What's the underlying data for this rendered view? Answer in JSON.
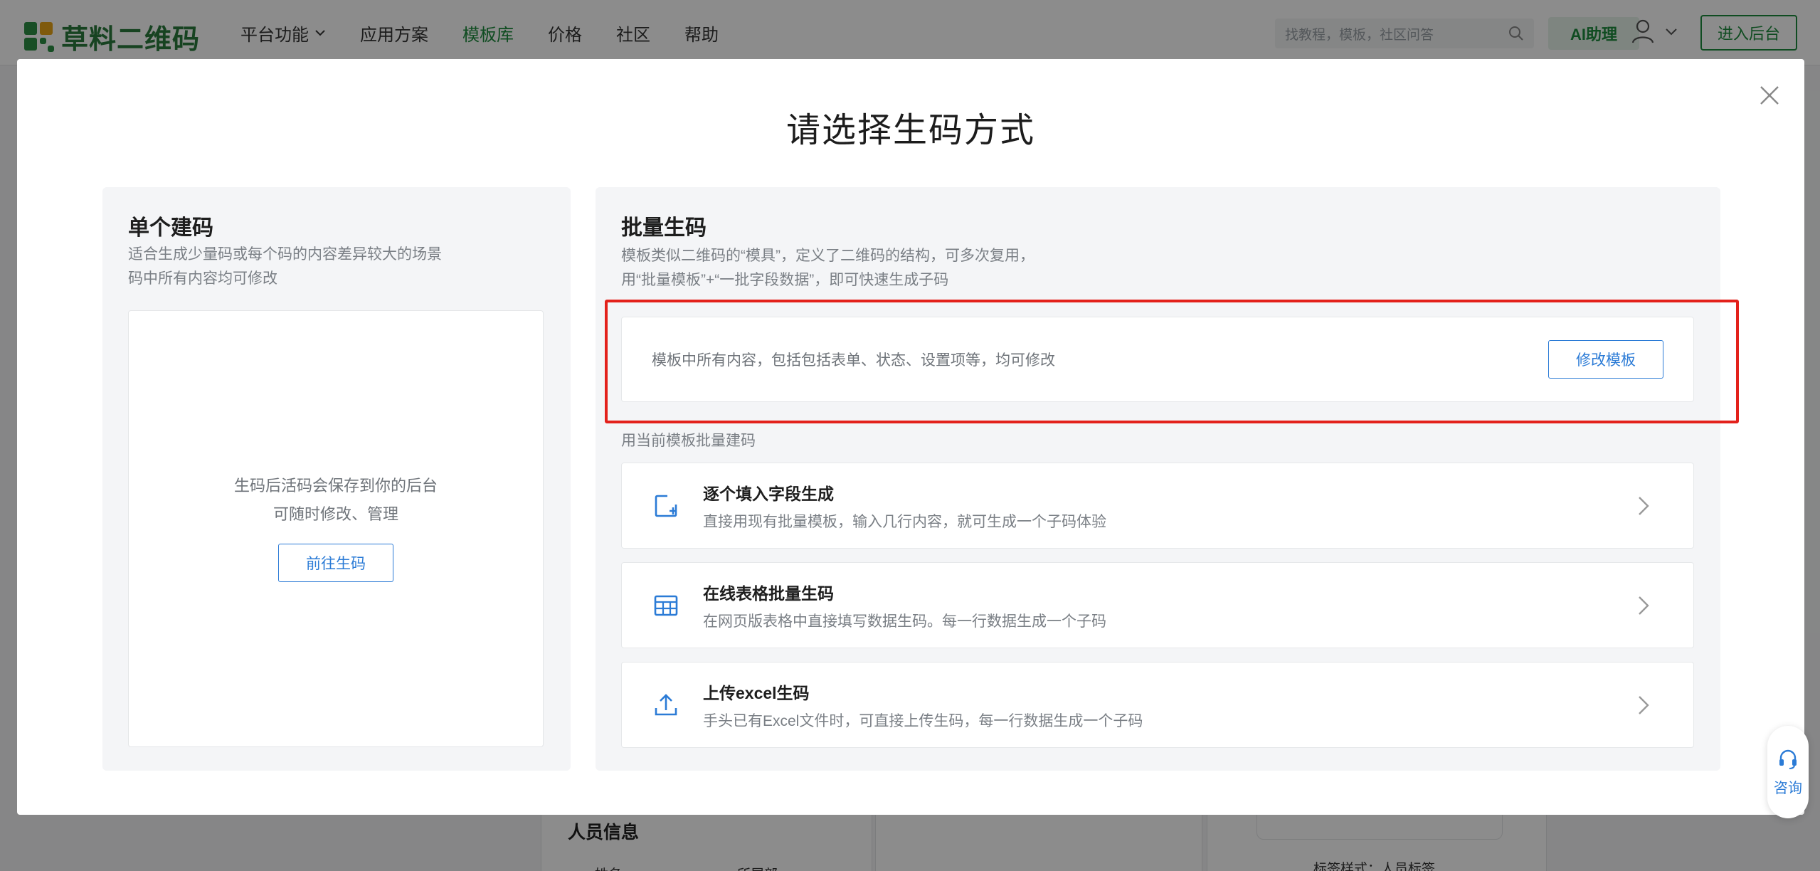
{
  "nav": {
    "logo_text": "草料二维码",
    "items": [
      {
        "label": "平台功能",
        "has_dropdown": true,
        "active": false
      },
      {
        "label": "应用方案",
        "has_dropdown": false,
        "active": false
      },
      {
        "label": "模板库",
        "has_dropdown": false,
        "active": true
      },
      {
        "label": "价格",
        "has_dropdown": false,
        "active": false
      },
      {
        "label": "社区",
        "has_dropdown": false,
        "active": false
      },
      {
        "label": "帮助",
        "has_dropdown": false,
        "active": false
      }
    ],
    "search_placeholder": "找教程，模板，社区问答",
    "ai_label": "AI助理",
    "enter_label": "进入后台"
  },
  "background": {
    "section_title": "人员信息",
    "col_a": "姓名",
    "col_b": "所属部",
    "label_text": "标签样式：人员标签"
  },
  "modal": {
    "title": "请选择生码方式",
    "single": {
      "title": "单个建码",
      "desc_line1": "适合生成少量码或每个码的内容差异较大的场景",
      "desc_line2": "码中所有内容均可修改",
      "info_line1": "生码后活码会保存到你的后台",
      "info_line2": "可随时修改、管理",
      "button": "前往生码"
    },
    "batch": {
      "title": "批量生码",
      "desc_line1": "模板类似二维码的“模具”，定义了二维码的结构，可多次复用，",
      "desc_line2": "用“批量模板”+“一批字段数据”，即可快速生成子码",
      "edit_text": "模板中所有内容，包括包括表单、状态、设置项等，均可修改",
      "edit_button": "修改模板",
      "section_label": "用当前模板批量建码",
      "options": [
        {
          "icon": "add-field-icon",
          "title": "逐个填入字段生成",
          "desc": "直接用现有批量模板，输入几行内容，就可生成一个子码体验"
        },
        {
          "icon": "table-icon",
          "title": "在线表格批量生码",
          "desc": "在网页版表格中直接填写数据生码。每一行数据生成一个子码"
        },
        {
          "icon": "upload-icon",
          "title": "上传excel生码",
          "desc": "手头已有Excel文件时，可直接上传生码，每一行数据生成一个子码"
        }
      ]
    }
  },
  "consult": {
    "label": "咨询"
  },
  "colors": {
    "brand_green": "#1d8a3c",
    "link_blue": "#2b7bd6",
    "highlight_red": "#e3211b"
  }
}
